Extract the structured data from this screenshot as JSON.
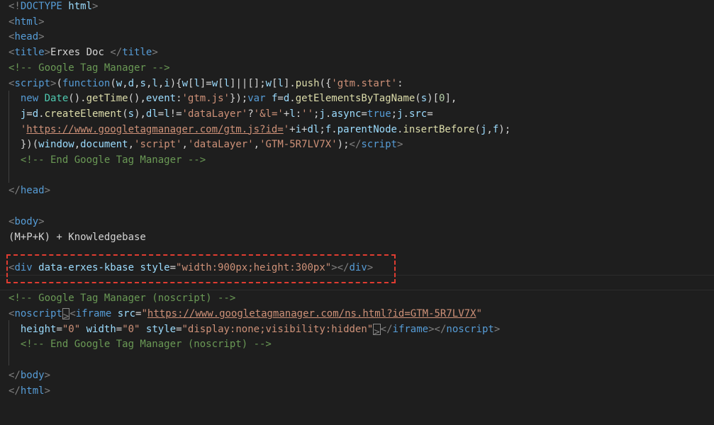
{
  "colors": {
    "background": "#1e1e1e",
    "tag_bracket": "#808080",
    "tag_name": "#569cd6",
    "attribute": "#9cdcfe",
    "string": "#ce9178",
    "comment": "#6a9955",
    "function": "#dcdcaa",
    "keyword": "#569cd6",
    "text": "#d4d4d4",
    "class_name": "#4ec9b0",
    "number": "#b5cea8",
    "highlight_border": "#e03c31"
  },
  "code_lines": [
    [
      {
        "t": "<!",
        "c": "#808080"
      },
      {
        "t": "DOCTYPE",
        "c": "#569cd6"
      },
      {
        "t": " html",
        "c": "#9cdcfe"
      },
      {
        "t": ">",
        "c": "#808080"
      }
    ],
    [
      {
        "t": "<",
        "c": "#808080"
      },
      {
        "t": "html",
        "c": "#569cd6"
      },
      {
        "t": ">",
        "c": "#808080"
      }
    ],
    [
      {
        "t": "<",
        "c": "#808080"
      },
      {
        "t": "head",
        "c": "#569cd6"
      },
      {
        "t": ">",
        "c": "#808080"
      }
    ],
    [
      {
        "t": "<",
        "c": "#808080"
      },
      {
        "t": "title",
        "c": "#569cd6"
      },
      {
        "t": ">",
        "c": "#808080"
      },
      {
        "t": "Erxes Doc ",
        "c": "#d4d4d4"
      },
      {
        "t": "</",
        "c": "#808080"
      },
      {
        "t": "title",
        "c": "#569cd6"
      },
      {
        "t": ">",
        "c": "#808080"
      }
    ],
    [
      {
        "t": "<!-- Google Tag Manager -->",
        "c": "#6a9955"
      }
    ],
    [
      {
        "t": "<",
        "c": "#808080"
      },
      {
        "t": "script",
        "c": "#569cd6"
      },
      {
        "t": ">",
        "c": "#808080"
      },
      {
        "t": "(",
        "c": "#d4d4d4"
      },
      {
        "t": "function",
        "c": "#569cd6"
      },
      {
        "t": "(",
        "c": "#d4d4d4"
      },
      {
        "t": "w",
        "c": "#9cdcfe"
      },
      {
        "t": ",",
        "c": "#d4d4d4"
      },
      {
        "t": "d",
        "c": "#9cdcfe"
      },
      {
        "t": ",",
        "c": "#d4d4d4"
      },
      {
        "t": "s",
        "c": "#9cdcfe"
      },
      {
        "t": ",",
        "c": "#d4d4d4"
      },
      {
        "t": "l",
        "c": "#9cdcfe"
      },
      {
        "t": ",",
        "c": "#d4d4d4"
      },
      {
        "t": "i",
        "c": "#9cdcfe"
      },
      {
        "t": "){",
        "c": "#d4d4d4"
      },
      {
        "t": "w",
        "c": "#9cdcfe"
      },
      {
        "t": "[",
        "c": "#d4d4d4"
      },
      {
        "t": "l",
        "c": "#9cdcfe"
      },
      {
        "t": "]=",
        "c": "#d4d4d4"
      },
      {
        "t": "w",
        "c": "#9cdcfe"
      },
      {
        "t": "[",
        "c": "#d4d4d4"
      },
      {
        "t": "l",
        "c": "#9cdcfe"
      },
      {
        "t": "]||[];",
        "c": "#d4d4d4"
      },
      {
        "t": "w",
        "c": "#9cdcfe"
      },
      {
        "t": "[",
        "c": "#d4d4d4"
      },
      {
        "t": "l",
        "c": "#9cdcfe"
      },
      {
        "t": "].",
        "c": "#d4d4d4"
      },
      {
        "t": "push",
        "c": "#dcdcaa"
      },
      {
        "t": "({",
        "c": "#d4d4d4"
      },
      {
        "t": "'gtm.start'",
        "c": "#ce9178"
      },
      {
        "t": ":",
        "c": "#d4d4d4"
      }
    ],
    [
      {
        "t": "  new ",
        "c": "#569cd6"
      },
      {
        "t": "Date",
        "c": "#4ec9b0"
      },
      {
        "t": "().",
        "c": "#d4d4d4"
      },
      {
        "t": "getTime",
        "c": "#dcdcaa"
      },
      {
        "t": "(),",
        "c": "#d4d4d4"
      },
      {
        "t": "event",
        "c": "#9cdcfe"
      },
      {
        "t": ":",
        "c": "#d4d4d4"
      },
      {
        "t": "'gtm.js'",
        "c": "#ce9178"
      },
      {
        "t": "});",
        "c": "#d4d4d4"
      },
      {
        "t": "var ",
        "c": "#569cd6"
      },
      {
        "t": "f",
        "c": "#9cdcfe"
      },
      {
        "t": "=",
        "c": "#d4d4d4"
      },
      {
        "t": "d",
        "c": "#9cdcfe"
      },
      {
        "t": ".",
        "c": "#d4d4d4"
      },
      {
        "t": "getElementsByTagName",
        "c": "#dcdcaa"
      },
      {
        "t": "(",
        "c": "#d4d4d4"
      },
      {
        "t": "s",
        "c": "#9cdcfe"
      },
      {
        "t": ")[",
        "c": "#d4d4d4"
      },
      {
        "t": "0",
        "c": "#b5cea8"
      },
      {
        "t": "],",
        "c": "#d4d4d4"
      }
    ],
    [
      {
        "t": "  j",
        "c": "#9cdcfe"
      },
      {
        "t": "=",
        "c": "#d4d4d4"
      },
      {
        "t": "d",
        "c": "#9cdcfe"
      },
      {
        "t": ".",
        "c": "#d4d4d4"
      },
      {
        "t": "createElement",
        "c": "#dcdcaa"
      },
      {
        "t": "(",
        "c": "#d4d4d4"
      },
      {
        "t": "s",
        "c": "#9cdcfe"
      },
      {
        "t": "),",
        "c": "#d4d4d4"
      },
      {
        "t": "dl",
        "c": "#9cdcfe"
      },
      {
        "t": "=",
        "c": "#d4d4d4"
      },
      {
        "t": "l",
        "c": "#9cdcfe"
      },
      {
        "t": "!=",
        "c": "#d4d4d4"
      },
      {
        "t": "'dataLayer'",
        "c": "#ce9178"
      },
      {
        "t": "?",
        "c": "#d4d4d4"
      },
      {
        "t": "'&l='",
        "c": "#ce9178"
      },
      {
        "t": "+",
        "c": "#d4d4d4"
      },
      {
        "t": "l",
        "c": "#9cdcfe"
      },
      {
        "t": ":",
        "c": "#d4d4d4"
      },
      {
        "t": "''",
        "c": "#ce9178"
      },
      {
        "t": ";",
        "c": "#d4d4d4"
      },
      {
        "t": "j",
        "c": "#9cdcfe"
      },
      {
        "t": ".",
        "c": "#d4d4d4"
      },
      {
        "t": "async",
        "c": "#9cdcfe"
      },
      {
        "t": "=",
        "c": "#d4d4d4"
      },
      {
        "t": "true",
        "c": "#569cd6"
      },
      {
        "t": ";",
        "c": "#d4d4d4"
      },
      {
        "t": "j",
        "c": "#9cdcfe"
      },
      {
        "t": ".",
        "c": "#d4d4d4"
      },
      {
        "t": "src",
        "c": "#9cdcfe"
      },
      {
        "t": "=",
        "c": "#d4d4d4"
      }
    ],
    [
      {
        "t": "  '",
        "c": "#ce9178"
      },
      {
        "t": "https://www.googletagmanager.com/gtm.js?id=",
        "c": "#ce9178",
        "u": true
      },
      {
        "t": "'",
        "c": "#ce9178"
      },
      {
        "t": "+",
        "c": "#d4d4d4"
      },
      {
        "t": "i",
        "c": "#9cdcfe"
      },
      {
        "t": "+",
        "c": "#d4d4d4"
      },
      {
        "t": "dl",
        "c": "#9cdcfe"
      },
      {
        "t": ";",
        "c": "#d4d4d4"
      },
      {
        "t": "f",
        "c": "#9cdcfe"
      },
      {
        "t": ".",
        "c": "#d4d4d4"
      },
      {
        "t": "parentNode",
        "c": "#9cdcfe"
      },
      {
        "t": ".",
        "c": "#d4d4d4"
      },
      {
        "t": "insertBefore",
        "c": "#dcdcaa"
      },
      {
        "t": "(",
        "c": "#d4d4d4"
      },
      {
        "t": "j",
        "c": "#9cdcfe"
      },
      {
        "t": ",",
        "c": "#d4d4d4"
      },
      {
        "t": "f",
        "c": "#9cdcfe"
      },
      {
        "t": ");",
        "c": "#d4d4d4"
      }
    ],
    [
      {
        "t": "  })(",
        "c": "#d4d4d4"
      },
      {
        "t": "window",
        "c": "#9cdcfe"
      },
      {
        "t": ",",
        "c": "#d4d4d4"
      },
      {
        "t": "document",
        "c": "#9cdcfe"
      },
      {
        "t": ",",
        "c": "#d4d4d4"
      },
      {
        "t": "'script'",
        "c": "#ce9178"
      },
      {
        "t": ",",
        "c": "#d4d4d4"
      },
      {
        "t": "'dataLayer'",
        "c": "#ce9178"
      },
      {
        "t": ",",
        "c": "#d4d4d4"
      },
      {
        "t": "'GTM-5R7LV7X'",
        "c": "#ce9178"
      },
      {
        "t": ");",
        "c": "#d4d4d4"
      },
      {
        "t": "</",
        "c": "#808080"
      },
      {
        "t": "script",
        "c": "#569cd6"
      },
      {
        "t": ">",
        "c": "#808080"
      }
    ],
    [
      {
        "t": "  <!-- End Google Tag Manager -->",
        "c": "#6a9955"
      }
    ],
    [],
    [
      {
        "t": "</",
        "c": "#808080"
      },
      {
        "t": "head",
        "c": "#569cd6"
      },
      {
        "t": ">",
        "c": "#808080"
      }
    ],
    [],
    [
      {
        "t": "<",
        "c": "#808080"
      },
      {
        "t": "body",
        "c": "#569cd6"
      },
      {
        "t": ">",
        "c": "#808080"
      }
    ],
    [
      {
        "t": "(M+P+K) + Knowledgebase",
        "c": "#d4d4d4"
      }
    ],
    [],
    [
      {
        "t": "<",
        "c": "#808080"
      },
      {
        "t": "div",
        "c": "#569cd6"
      },
      {
        "t": " data-erxes-kbase",
        "c": "#9cdcfe"
      },
      {
        "t": " style",
        "c": "#9cdcfe"
      },
      {
        "t": "=",
        "c": "#d4d4d4"
      },
      {
        "t": "\"width:900px;height:300px\"",
        "c": "#ce9178"
      },
      {
        "t": "></",
        "c": "#808080"
      },
      {
        "t": "div",
        "c": "#569cd6"
      },
      {
        "t": ">",
        "c": "#808080"
      }
    ],
    [],
    [
      {
        "t": "<!-- Google Tag Manager (noscript) -->",
        "c": "#6a9955"
      }
    ],
    [
      {
        "t": "<",
        "c": "#808080"
      },
      {
        "t": "noscript",
        "c": "#569cd6"
      },
      {
        "t": ">",
        "c": "#808080",
        "box": true
      },
      {
        "t": "<",
        "c": "#808080"
      },
      {
        "t": "iframe",
        "c": "#569cd6"
      },
      {
        "t": " src",
        "c": "#9cdcfe"
      },
      {
        "t": "=",
        "c": "#d4d4d4"
      },
      {
        "t": "\"",
        "c": "#ce9178"
      },
      {
        "t": "https://www.googletagmanager.com/ns.html?id=GTM-5R7LV7X",
        "c": "#ce9178",
        "u": true
      },
      {
        "t": "\"",
        "c": "#ce9178"
      }
    ],
    [
      {
        "t": "  height",
        "c": "#9cdcfe"
      },
      {
        "t": "=",
        "c": "#d4d4d4"
      },
      {
        "t": "\"0\"",
        "c": "#ce9178"
      },
      {
        "t": " width",
        "c": "#9cdcfe"
      },
      {
        "t": "=",
        "c": "#d4d4d4"
      },
      {
        "t": "\"0\"",
        "c": "#ce9178"
      },
      {
        "t": " style",
        "c": "#9cdcfe"
      },
      {
        "t": "=",
        "c": "#d4d4d4"
      },
      {
        "t": "\"display:none;visibility:hidden\"",
        "c": "#ce9178"
      },
      {
        "t": ">",
        "c": "#808080",
        "box": true
      },
      {
        "t": "</",
        "c": "#808080"
      },
      {
        "t": "iframe",
        "c": "#569cd6"
      },
      {
        "t": "></",
        "c": "#808080"
      },
      {
        "t": "noscript",
        "c": "#569cd6"
      },
      {
        "t": ">",
        "c": "#808080"
      }
    ],
    [
      {
        "t": "  <!-- End Google Tag Manager (noscript) -->",
        "c": "#6a9955"
      }
    ],
    [],
    [
      {
        "t": "</",
        "c": "#808080"
      },
      {
        "t": "body",
        "c": "#569cd6"
      },
      {
        "t": ">",
        "c": "#808080"
      }
    ],
    [
      {
        "t": "</",
        "c": "#808080"
      },
      {
        "t": "html",
        "c": "#569cd6"
      },
      {
        "t": ">",
        "c": "#808080"
      }
    ]
  ]
}
